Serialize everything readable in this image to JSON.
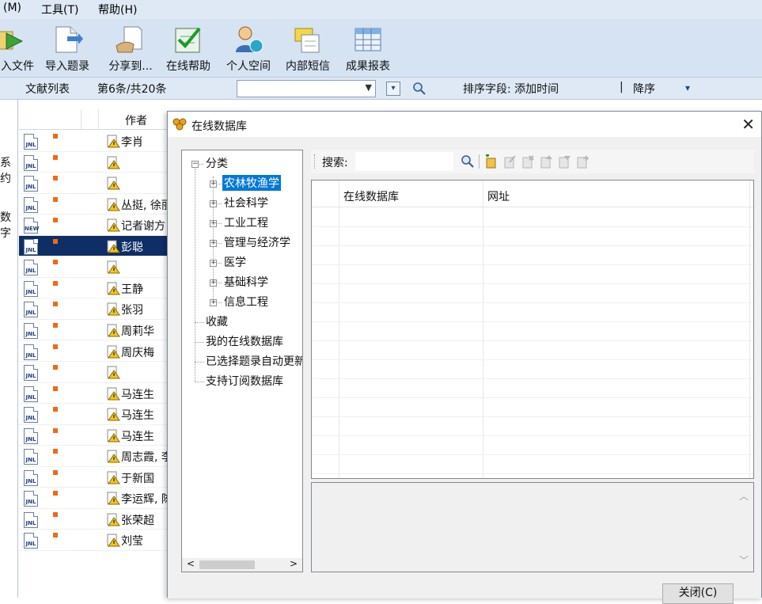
{
  "menu": {
    "items": [
      "(M)",
      "工具(T)",
      "帮助(H)"
    ]
  },
  "toolbar": {
    "buttons": [
      "入文件",
      "导入题录",
      "分享到...",
      "在线帮助",
      "个人空间",
      "内部短信",
      "成果报表"
    ]
  },
  "listbar": {
    "title": "文献列表",
    "count": "第6条/共20条",
    "sort_label": "排序字段: 添加时间",
    "separator": "|",
    "order": "降序",
    "order_arrow": "▾"
  },
  "leftpanel": {
    "snippets": [
      "系约",
      "数字"
    ]
  },
  "list": {
    "header_author": "作者",
    "rows": [
      {
        "badge": "JNL",
        "author": "李肖"
      },
      {
        "badge": "JNL",
        "author": ""
      },
      {
        "badge": "JNL",
        "author": ""
      },
      {
        "badge": "JNL",
        "author": "丛挺, 徐丽"
      },
      {
        "badge": "NEW",
        "author": "记者谢方"
      },
      {
        "badge": "JNL",
        "author": "彭聪"
      },
      {
        "badge": "JNL",
        "author": ""
      },
      {
        "badge": "JNL",
        "author": "王静"
      },
      {
        "badge": "JNL",
        "author": "张羽"
      },
      {
        "badge": "JNL",
        "author": "周莉华"
      },
      {
        "badge": "JNL",
        "author": "周庆梅"
      },
      {
        "badge": "JNL",
        "author": ""
      },
      {
        "badge": "JNL",
        "author": "马连生"
      },
      {
        "badge": "JNL",
        "author": "马连生"
      },
      {
        "badge": "JNL",
        "author": "马连生"
      },
      {
        "badge": "JNL",
        "author": "周志霞, 李"
      },
      {
        "badge": "JNL",
        "author": "于新国"
      },
      {
        "badge": "JNL",
        "author": "李运辉, 陈"
      },
      {
        "badge": "JNL",
        "author": "张荣超"
      },
      {
        "badge": "JNL",
        "author": "刘莹"
      }
    ],
    "selected_index": 5
  },
  "dialog": {
    "title": "在线数据库",
    "close_glyph": "✕",
    "tree": {
      "root": "分类",
      "categories": [
        "农林牧渔学",
        "社会科学",
        "工业工程",
        "管理与经济学",
        "医学",
        "基础科学",
        "信息工程"
      ],
      "others": [
        "收藏",
        "我的在线数据库",
        "已选择题录自动更新",
        "支持订阅数据库"
      ],
      "scroll_left": "<",
      "scroll_right": ">"
    },
    "search_label": "搜索:",
    "search_value": "",
    "grid_headers": [
      "在线数据库",
      "网址"
    ],
    "close_button": "关闭(C)"
  },
  "colors": {
    "selection": "#0f2e66",
    "tree_selection": "#0078d7",
    "flag": "#f06a10",
    "toolbar_bg": "#d6e3f2"
  }
}
